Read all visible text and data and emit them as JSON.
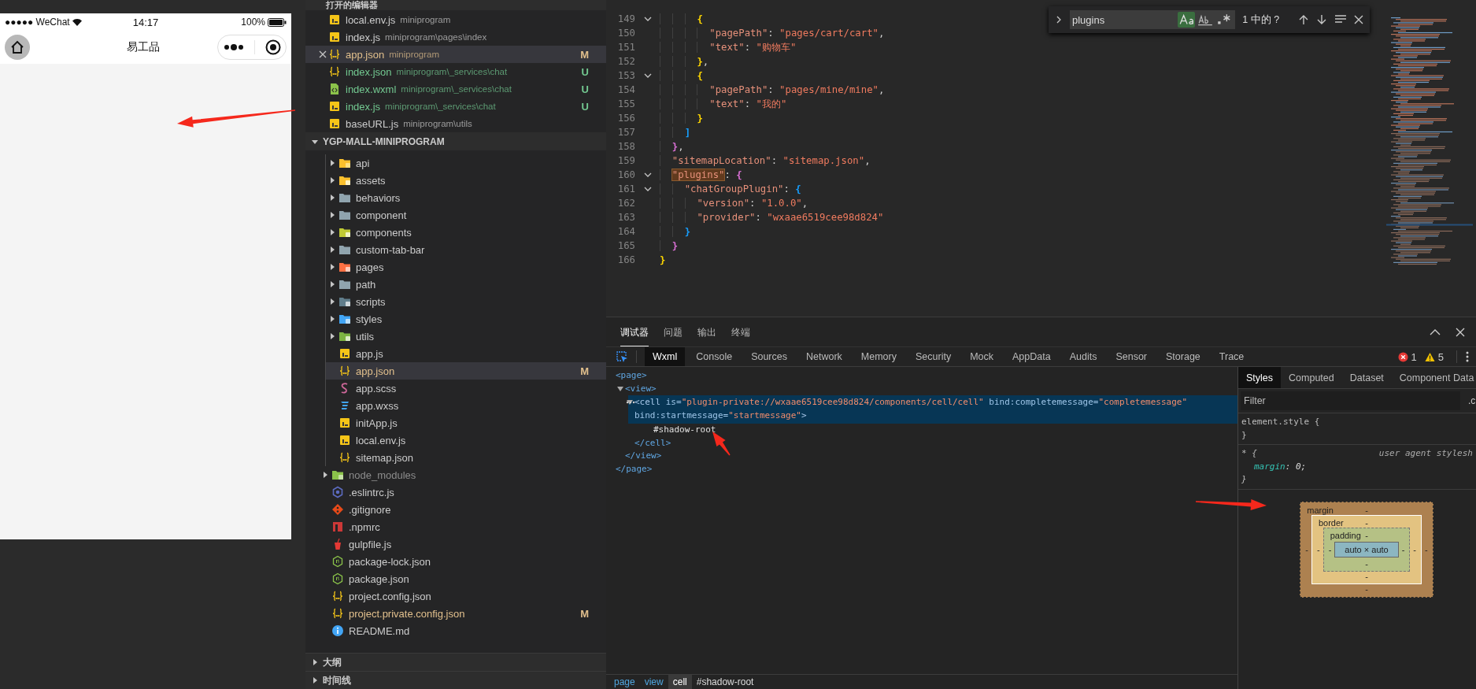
{
  "simulator": {
    "status_bar": {
      "carrier": "●●●●● WeChat",
      "time": "14:17",
      "battery": "100%"
    },
    "nav_bar": {
      "title": "易工品"
    }
  },
  "explorer": {
    "open_editors": {
      "title": "打开的编辑器",
      "items": [
        {
          "kind": "js",
          "name": "local.env.js",
          "path": "miniprogram",
          "color": "#cccccc",
          "selected": false
        },
        {
          "kind": "js",
          "name": "index.js",
          "path": "miniprogram\\pages\\index",
          "color": "#cccccc",
          "selected": false
        },
        {
          "kind": "json",
          "name": "app.json",
          "path": "miniprogram",
          "color": "#e2c08d",
          "badge": "M",
          "selected": true
        },
        {
          "kind": "json",
          "name": "index.json",
          "path": "miniprogram\\_services\\chat",
          "color": "#73c991",
          "badge": "U",
          "selected": false
        },
        {
          "kind": "wxml",
          "name": "index.wxml",
          "path": "miniprogram\\_services\\chat",
          "color": "#73c991",
          "badge": "U",
          "selected": false
        },
        {
          "kind": "js",
          "name": "index.js",
          "path": "miniprogram\\_services\\chat",
          "color": "#73c991",
          "badge": "U",
          "selected": false
        },
        {
          "kind": "js",
          "name": "baseURL.js",
          "path": "miniprogram\\utils",
          "color": "#cccccc",
          "selected": false
        }
      ]
    },
    "project": {
      "title": "YGP-MALL-MINIPROGRAM",
      "expanded": true,
      "items": [
        {
          "kind": "group",
          "children": [
            {
              "kind": "folder-api",
              "name": "api",
              "expanded": false,
              "color": "#cccccc",
              "selected": false
            },
            {
              "kind": "folder-assets",
              "name": "assets",
              "expanded": false,
              "color": "#cccccc",
              "selected": false
            },
            {
              "kind": "folder",
              "name": "behaviors",
              "expanded": false,
              "color": "#cccccc",
              "selected": false
            },
            {
              "kind": "folder",
              "name": "component",
              "expanded": false,
              "color": "#cccccc",
              "selected": false
            },
            {
              "kind": "folder-components",
              "name": "components",
              "expanded": false,
              "color": "#cccccc",
              "selected": false
            },
            {
              "kind": "folder",
              "name": "custom-tab-bar",
              "expanded": false,
              "color": "#cccccc",
              "selected": false
            },
            {
              "kind": "folder-pages",
              "name": "pages",
              "expanded": false,
              "color": "#cccccc",
              "selected": false
            },
            {
              "kind": "folder",
              "name": "path",
              "expanded": false,
              "color": "#cccccc",
              "selected": false
            },
            {
              "kind": "folder-scripts",
              "name": "scripts",
              "expanded": false,
              "color": "#cccccc",
              "selected": false
            },
            {
              "kind": "folder-styles",
              "name": "styles",
              "expanded": false,
              "color": "#cccccc",
              "selected": false
            },
            {
              "kind": "folder-utils",
              "name": "utils",
              "expanded": false,
              "color": "#cccccc",
              "selected": false
            },
            {
              "kind": "js",
              "name": "app.js",
              "color": "#cccccc",
              "selected": false
            },
            {
              "kind": "json",
              "name": "app.json",
              "color": "#e2c08d",
              "badge": "M",
              "selected": true
            },
            {
              "kind": "scss",
              "name": "app.scss",
              "color": "#cccccc",
              "selected": false
            },
            {
              "kind": "wxss",
              "name": "app.wxss",
              "color": "#cccccc",
              "selected": false
            },
            {
              "kind": "js",
              "name": "initApp.js",
              "color": "#cccccc",
              "selected": false
            },
            {
              "kind": "js",
              "name": "local.env.js",
              "color": "#cccccc",
              "selected": false
            },
            {
              "kind": "json",
              "name": "sitemap.json",
              "color": "#cccccc",
              "selected": false
            }
          ]
        },
        {
          "kind": "folder-node",
          "name": "node_modules",
          "expanded": false,
          "color": "#8c8c8c",
          "selected": false
        },
        {
          "kind": "eslint",
          "name": ".eslintrc.js",
          "color": "#cccccc",
          "selected": false
        },
        {
          "kind": "git",
          "name": ".gitignore",
          "color": "#cccccc",
          "selected": false
        },
        {
          "kind": "npm",
          "name": ".npmrc",
          "color": "#cccccc",
          "selected": false
        },
        {
          "kind": "gulp",
          "name": "gulpfile.js",
          "color": "#cccccc",
          "selected": false
        },
        {
          "kind": "nodejs",
          "name": "package-lock.json",
          "color": "#cccccc",
          "selected": false
        },
        {
          "kind": "nodejs",
          "name": "package.json",
          "color": "#cccccc",
          "selected": false
        },
        {
          "kind": "json",
          "name": "project.config.json",
          "color": "#cccccc",
          "selected": false
        },
        {
          "kind": "json",
          "name": "project.private.config.json",
          "color": "#e2c08d",
          "badge": "M",
          "selected": false
        },
        {
          "kind": "info",
          "name": "README.md",
          "color": "#cccccc",
          "selected": false
        }
      ]
    },
    "sections": [
      {
        "title": "大纲",
        "expanded": false
      },
      {
        "title": "时间线",
        "expanded": false
      }
    ]
  },
  "editor": {
    "lines": [
      {
        "number": "149",
        "fold": true,
        "tokens": [
          {
            "kind": "bracket",
            "text": "      {",
            "color": "#ffd700"
          }
        ]
      },
      {
        "number": "150",
        "fold": false,
        "tokens": [
          {
            "kind": "key",
            "text": "        \"pagePath\""
          },
          {
            "kind": "punct",
            "text": ": "
          },
          {
            "kind": "string",
            "text": "\"pages/cart/cart\""
          },
          {
            "kind": "punct",
            "text": ","
          }
        ]
      },
      {
        "number": "151",
        "fold": false,
        "tokens": [
          {
            "kind": "key",
            "text": "        \"text\""
          },
          {
            "kind": "punct",
            "text": ": "
          },
          {
            "kind": "string",
            "text": "\"购物车\""
          }
        ]
      },
      {
        "number": "152",
        "fold": false,
        "tokens": [
          {
            "kind": "bracket",
            "text": "      }",
            "color": "#ffd700"
          },
          {
            "kind": "punct",
            "text": ","
          }
        ]
      },
      {
        "number": "153",
        "fold": true,
        "tokens": [
          {
            "kind": "bracket",
            "text": "      {",
            "color": "#ffd700"
          }
        ]
      },
      {
        "number": "154",
        "fold": false,
        "tokens": [
          {
            "kind": "key",
            "text": "        \"pagePath\""
          },
          {
            "kind": "punct",
            "text": ": "
          },
          {
            "kind": "string",
            "text": "\"pages/mine/mine\""
          },
          {
            "kind": "punct",
            "text": ","
          }
        ]
      },
      {
        "number": "155",
        "fold": false,
        "tokens": [
          {
            "kind": "key",
            "text": "        \"text\""
          },
          {
            "kind": "punct",
            "text": ": "
          },
          {
            "kind": "string",
            "text": "\"我的\""
          }
        ]
      },
      {
        "number": "156",
        "fold": false,
        "tokens": [
          {
            "kind": "bracket",
            "text": "      }",
            "color": "#ffd700"
          }
        ]
      },
      {
        "number": "157",
        "fold": false,
        "tokens": [
          {
            "kind": "bracket",
            "text": "    ]",
            "color": "#179fff"
          }
        ]
      },
      {
        "number": "158",
        "fold": false,
        "tokens": [
          {
            "kind": "bracket",
            "text": "  }",
            "color": "#da70d6"
          },
          {
            "kind": "punct",
            "text": ","
          }
        ]
      },
      {
        "number": "159",
        "fold": false,
        "tokens": [
          {
            "kind": "key",
            "text": "  \"sitemapLocation\""
          },
          {
            "kind": "punct",
            "text": ": "
          },
          {
            "kind": "string",
            "text": "\"sitemap.json\""
          },
          {
            "kind": "punct",
            "text": ","
          }
        ]
      },
      {
        "number": "160",
        "fold": true,
        "tokens": [
          {
            "kind": "key",
            "text": "  \"plugins\"",
            "match": true
          },
          {
            "kind": "punct",
            "text": ": "
          },
          {
            "kind": "bracket",
            "text": "{",
            "color": "#da70d6"
          }
        ]
      },
      {
        "number": "161",
        "fold": true,
        "tokens": [
          {
            "kind": "key",
            "text": "    \"chatGroupPlugin\""
          },
          {
            "kind": "punct",
            "text": ": "
          },
          {
            "kind": "bracket",
            "text": "{",
            "color": "#179fff"
          }
        ]
      },
      {
        "number": "162",
        "fold": false,
        "tokens": [
          {
            "kind": "key",
            "text": "      \"version\""
          },
          {
            "kind": "punct",
            "text": ": "
          },
          {
            "kind": "string",
            "text": "\"1.0.0\""
          },
          {
            "kind": "punct",
            "text": ","
          }
        ]
      },
      {
        "number": "163",
        "fold": false,
        "tokens": [
          {
            "kind": "key",
            "text": "      \"provider\""
          },
          {
            "kind": "punct",
            "text": ": "
          },
          {
            "kind": "string",
            "text": "\"wxaae6519cee98d824\""
          }
        ]
      },
      {
        "number": "164",
        "fold": false,
        "tokens": [
          {
            "kind": "bracket",
            "text": "    }",
            "color": "#179fff"
          }
        ]
      },
      {
        "number": "165",
        "fold": false,
        "tokens": [
          {
            "kind": "bracket",
            "text": "  }",
            "color": "#da70d6"
          }
        ]
      },
      {
        "number": "166",
        "fold": false,
        "tokens": [
          {
            "kind": "bracket",
            "text": "}",
            "color": "#ffd700"
          }
        ]
      }
    ],
    "find": {
      "query": "plugins",
      "result": "1 中的 ?",
      "match_case": true,
      "whole_word": false,
      "regex": false
    }
  },
  "debugger": {
    "panel_tabs": [
      {
        "label": "调试器",
        "selected": true
      },
      {
        "label": "问题",
        "selected": false
      },
      {
        "label": "输出",
        "selected": false
      },
      {
        "label": "终端",
        "selected": false
      }
    ],
    "tools": [
      {
        "label": "Wxml",
        "selected": true
      },
      {
        "label": "Console",
        "selected": false
      },
      {
        "label": "Sources",
        "selected": false
      },
      {
        "label": "Network",
        "selected": false
      },
      {
        "label": "Memory",
        "selected": false
      },
      {
        "label": "Security",
        "selected": false
      },
      {
        "label": "Mock",
        "selected": false
      },
      {
        "label": "AppData",
        "selected": false
      },
      {
        "label": "Audits",
        "selected": false
      },
      {
        "label": "Sensor",
        "selected": false
      },
      {
        "label": "Storage",
        "selected": false
      },
      {
        "label": "Trace",
        "selected": false
      }
    ],
    "errors": "1",
    "warnings": "5",
    "wxml": [
      {
        "kind": "element",
        "selected": false,
        "tokens": [
          {
            "kind": "tag",
            "text": "<page>"
          }
        ],
        "close": "</page>",
        "children": [
          {
            "kind": "element",
            "selected": false,
            "expanded": true,
            "tokens": [
              {
                "kind": "tag",
                "text": "<view>"
              }
            ],
            "close": "</view>",
            "children": [
              {
                "kind": "element",
                "selected": true,
                "expanded": true,
                "tokens": [
                  {
                    "kind": "tag",
                    "text": "<cell"
                  },
                  {
                    "kind": "attr",
                    "text": " is="
                  },
                  {
                    "kind": "value",
                    "text": "\"plugin-private://wxaae6519cee98d824/components/cell/cell\""
                  },
                  {
                    "kind": "attr",
                    "text": " bind:completemessage="
                  },
                  {
                    "kind": "value",
                    "text": "\"completemessage\""
                  },
                  {
                    "kind": "attr",
                    "text": " bind:startmessage="
                  },
                  {
                    "kind": "value",
                    "text": "\"startmessage\""
                  },
                  {
                    "kind": "tag",
                    "text": ">"
                  }
                ],
                "close": "</cell>",
                "children": [
                  {
                    "kind": "text",
                    "selected": false,
                    "text": "#shadow-root"
                  }
                ]
              }
            ]
          }
        ]
      }
    ],
    "breadcrumb": [
      {
        "label": "page",
        "kind": "link",
        "selected": false
      },
      {
        "label": "view",
        "kind": "link",
        "selected": false
      },
      {
        "label": "cell",
        "kind": "link",
        "selected": true
      },
      {
        "label": "#shadow-root",
        "kind": "shadow",
        "selected": false
      }
    ],
    "styles": {
      "tabs": [
        {
          "label": "Styles",
          "selected": true
        },
        {
          "label": "Computed",
          "selected": false
        },
        {
          "label": "Dataset",
          "selected": false
        },
        {
          "label": "Component Data",
          "selected": false
        }
      ],
      "filter": {
        "placeholder": "Filter"
      },
      "class_toggle": ".c",
      "rules": [
        {
          "selector": "element.style {",
          "close": "}",
          "italic": false
        },
        {
          "selector": "* {",
          "source": "user agent stylesh",
          "declarations": [
            {
              "property": "margin",
              "rest": ": 0;"
            }
          ],
          "close": "}",
          "italic": true
        }
      ],
      "box_model": {
        "margin": {
          "label": "margin",
          "top": "-",
          "right": "-",
          "bottom": "-",
          "left": "-"
        },
        "border": {
          "label": "border",
          "top": "-",
          "right": "-",
          "bottom": "-",
          "left": "-"
        },
        "padding": {
          "label": "padding",
          "top": "-",
          "right": "-",
          "bottom": "-",
          "left": "-"
        },
        "content": "auto × auto"
      }
    }
  }
}
